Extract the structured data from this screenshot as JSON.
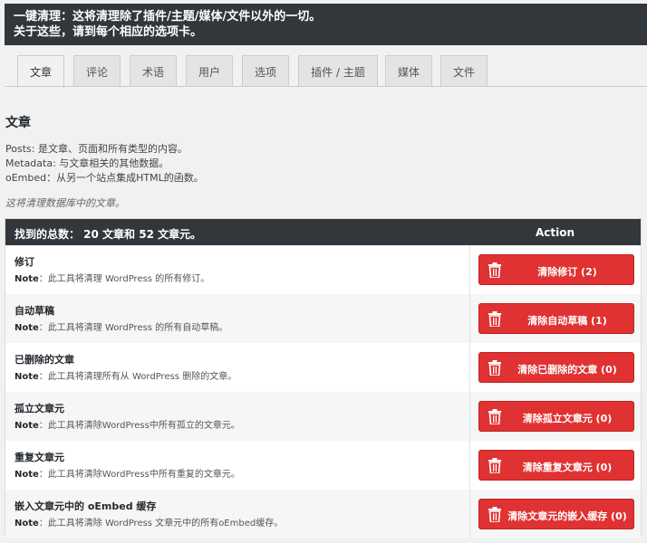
{
  "notice": {
    "line1": "一键清理：这将清理除了插件/主题/媒体/文件以外的一切。",
    "line2": "关于这些，请到每个相应的选项卡。"
  },
  "tabs": [
    {
      "label": "文章",
      "active": true
    },
    {
      "label": "评论",
      "active": false
    },
    {
      "label": "术语",
      "active": false
    },
    {
      "label": "用户",
      "active": false
    },
    {
      "label": "选项",
      "active": false
    },
    {
      "label": "插件 / 主题",
      "active": false
    },
    {
      "label": "媒体",
      "active": false
    },
    {
      "label": "文件",
      "active": false
    }
  ],
  "section": {
    "title": "文章",
    "desc": [
      "Posts: 是文章、页面和所有类型的内容。",
      "Metadata: 与文章相关的其他数据。",
      "oEmbed：从另一个站点集成HTML的函数。"
    ],
    "italic": "这将清理数据库中的文章。"
  },
  "table": {
    "header_left": "找到的总数： 20 文章和 52 文章元。",
    "header_right": "Action",
    "note_prefix": "Note",
    "rows": [
      {
        "title": "修订",
        "note": "：此工具将清理 WordPress 的所有修订。",
        "button": "清除修订 (2)"
      },
      {
        "title": "自动草稿",
        "note": "：此工具将清理 WordPress 的所有自动草稿。",
        "button": "清除自动草稿 (1)"
      },
      {
        "title": "已删除的文章",
        "note": "：此工具将清理所有从 WordPress 删除的文章。",
        "button": "清除已删除的文章 (0)"
      },
      {
        "title": "孤立文章元",
        "note": "：此工具将清除WordPress中所有孤立的文章元。",
        "button": "清除孤立文章元 (0)"
      },
      {
        "title": "重复文章元",
        "note": "：此工具将清除WordPress中所有重复的文章元。",
        "button": "清除重复文章元 (0)"
      },
      {
        "title": "嵌入文章元中的 oEmbed 缓存",
        "note": "：此工具将清除 WordPress 文章元中的所有oEmbed缓存。",
        "button": "清除文章元的嵌入缓存 (0)"
      }
    ]
  },
  "colors": {
    "header_bg": "#32373c",
    "button_red": "#e03232"
  }
}
